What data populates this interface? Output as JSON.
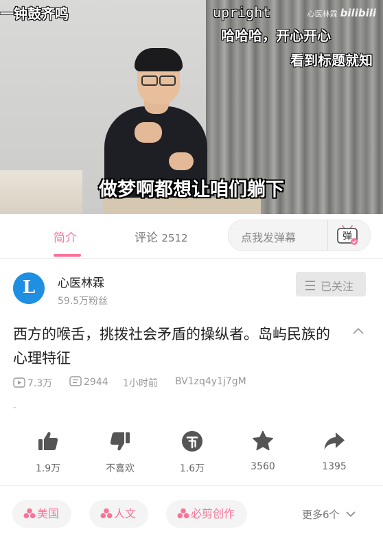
{
  "video": {
    "subtitle": "做梦啊都想让咱们躺下",
    "watermark_name": "心医林霖",
    "watermark_logo": "bilibili",
    "danmaku": [
      "一钟鼓齐鸣",
      "upright",
      "哈哈哈，开心开心",
      "看到标题就知"
    ]
  },
  "tabs": {
    "intro": "简介",
    "comments_label": "评论",
    "comments_count": "2512",
    "danmaku_placeholder": "点我发弹幕",
    "danmaku_icon_char": "弹"
  },
  "uploader": {
    "avatar_letter": "L",
    "name": "心医林霖",
    "fans": "59.5万粉丝",
    "follow_label": "已关注"
  },
  "video_info": {
    "title": "西方的喉舌，挑拨社会矛盾的操纵者。岛屿民族的心理特征",
    "views": "7.3万",
    "danmaku_count": "2944",
    "time": "1小时前",
    "bvid": "BV1zq4y1j7gM",
    "desc": "-"
  },
  "actions": {
    "like": "1.9万",
    "dislike": "不喜欢",
    "coin": "1.6万",
    "favorite": "3560",
    "share": "1395"
  },
  "tags": [
    "美国",
    "人文",
    "必剪创作"
  ],
  "more_tags": "更多6个",
  "colors": {
    "accent": "#fb7299",
    "avatar_bg": "#1e8fe1"
  }
}
